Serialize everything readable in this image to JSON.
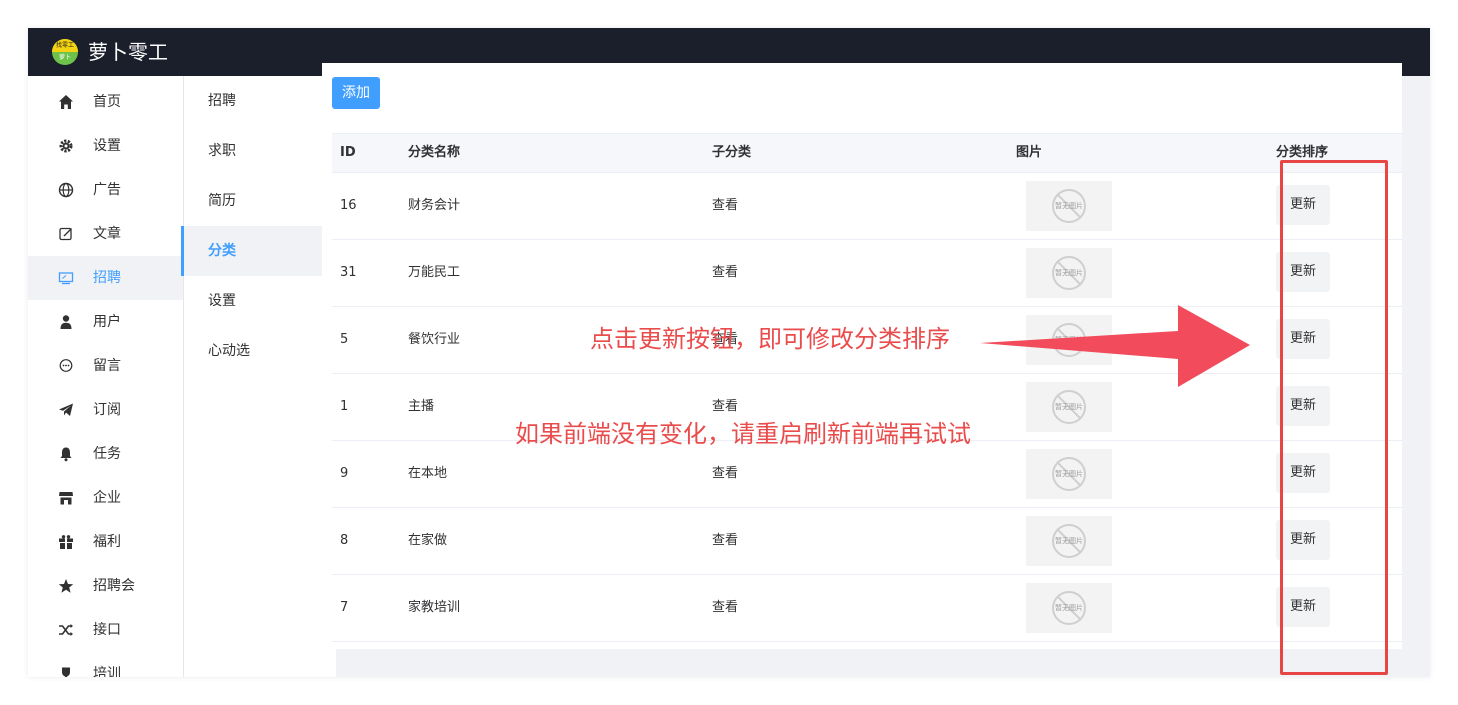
{
  "app": {
    "title": "萝卜零工",
    "logo_top": "找零工",
    "logo_bottom": "萝卜"
  },
  "sidebar": {
    "items": [
      {
        "label": "首页",
        "icon": "home-icon"
      },
      {
        "label": "设置",
        "icon": "gear-icon"
      },
      {
        "label": "广告",
        "icon": "globe-icon"
      },
      {
        "label": "文章",
        "icon": "edit-icon"
      },
      {
        "label": "招聘",
        "icon": "monitor-icon",
        "active": true
      },
      {
        "label": "用户",
        "icon": "user-icon"
      },
      {
        "label": "留言",
        "icon": "chat-icon"
      },
      {
        "label": "订阅",
        "icon": "send-icon"
      },
      {
        "label": "任务",
        "icon": "bell-icon"
      },
      {
        "label": "企业",
        "icon": "shop-icon"
      },
      {
        "label": "福利",
        "icon": "gift-icon"
      },
      {
        "label": "招聘会",
        "icon": "star-icon"
      },
      {
        "label": "接口",
        "icon": "shuffle-icon"
      },
      {
        "label": "培训",
        "icon": "trophy-icon"
      }
    ]
  },
  "submenu": {
    "items": [
      {
        "label": "招聘"
      },
      {
        "label": "求职"
      },
      {
        "label": "简历"
      },
      {
        "label": "分类",
        "active": true
      },
      {
        "label": "设置"
      },
      {
        "label": "心动选"
      }
    ]
  },
  "toolbar": {
    "add_label": "添加"
  },
  "table": {
    "headers": {
      "id": "ID",
      "name": "分类名称",
      "sub": "子分类",
      "image": "图片",
      "sort": "分类排序"
    },
    "image_placeholder": "暂无图片",
    "view_label": "查看",
    "update_label": "更新",
    "rows": [
      {
        "id": "16",
        "name": "财务会计"
      },
      {
        "id": "31",
        "name": "万能民工"
      },
      {
        "id": "5",
        "name": "餐饮行业"
      },
      {
        "id": "1",
        "name": "主播"
      },
      {
        "id": "9",
        "name": "在本地"
      },
      {
        "id": "8",
        "name": "在家做"
      },
      {
        "id": "7",
        "name": "家教培训"
      }
    ]
  },
  "annotations": {
    "note1": "点击更新按钮，即可修改分类排序",
    "note2": "如果前端没有变化，请重启刷新前端再试试",
    "color": "#ea4b4b"
  },
  "colors": {
    "accent": "#409eff",
    "topbar": "#1b1e2b",
    "annotation": "#e84545"
  }
}
